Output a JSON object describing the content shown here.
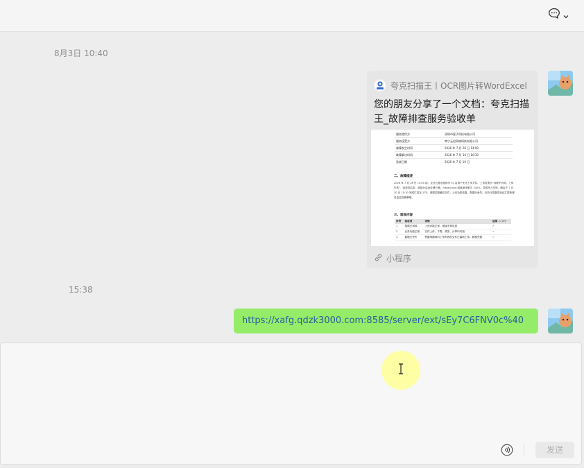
{
  "timestamps": [
    "8月3日 10:40",
    "15:38"
  ],
  "card": {
    "source": "夸克扫描王丨OCR图片转WordExcel",
    "title": "您的朋友分享了一个文档：夸克扫描王_故障排查服务验收单",
    "footer": "小程序",
    "doc": {
      "rows": [
        {
          "k": "服务提供方",
          "v": "深圳市星子科技有限公司"
        },
        {
          "k": "服务接受方",
          "v": "南宁云启网络科技有限公司"
        },
        {
          "k": "故障发生时间",
          "v": "2026 年 7 月 28 日 14:00"
        },
        {
          "k": "故障解决时间",
          "v": "2026 年 7 月 30 日 10:30"
        },
        {
          "k": "验收日期",
          "v": "2026 年 7 月 10 日"
        }
      ],
      "section2": "二、故障描述",
      "para": "2026 年 7 月 28 日 14:00 起，企业云盘出现部分 10 名用户无法上传文件、上传时提示“远程不可用、上传失败”，经排查后发，原因为后台存储已满，/data/cloud 磁盘使用率达 100%，导致写入失败。随后于 7 月 30 日 10:30 完成扩容至 1TB，清理过期缓存文件，上传功能恢复，数据无丢失。已执行恢复性验证并更新服务监控告警策略。",
      "section3": "三、验收内容",
      "table_headers": [
        "序号",
        "验收项",
        "详情",
        "结果（✓/✗）"
      ],
      "table_rows": [
        [
          "1",
          "故障已排除",
          "上传功能正常，错误不再出现",
          "✓"
        ],
        [
          "2",
          "业务功能正常",
          "文件上传、下载、预览、分享均可用",
          "✓"
        ],
        [
          "3",
          "数据无丢失",
          "受影响期间内上传失败的文件已重新上传，数据完整",
          "✓"
        ]
      ]
    }
  },
  "link_message": "https://xafg.qdzk3000.com:8585/server/ext/sEy7C6FNV0c%40",
  "input": {
    "send_label": "发送"
  }
}
